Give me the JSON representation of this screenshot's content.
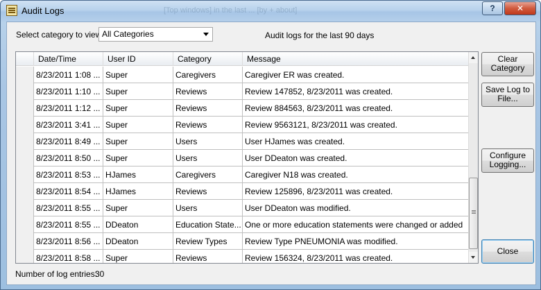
{
  "window": {
    "title": "Audit Logs",
    "help_label": "?",
    "close_label": "✕",
    "background_title": "[Top windows] in the last ... [by + about]"
  },
  "filter": {
    "label": "Select category to view:",
    "selected": "All Categories",
    "note": "Audit logs for the last 90 days"
  },
  "grid": {
    "columns": [
      "Date/Time",
      "User ID",
      "Category",
      "Message"
    ],
    "rows": [
      {
        "date": "8/23/2011 1:08 ...",
        "user": "Super",
        "category": "Caregivers",
        "message": "Caregiver ER was created."
      },
      {
        "date": "8/23/2011 1:10 ...",
        "user": "Super",
        "category": "Reviews",
        "message": "Review 147852,  8/23/2011 was created."
      },
      {
        "date": "8/23/2011 1:12 ...",
        "user": "Super",
        "category": "Reviews",
        "message": "Review 884563,  8/23/2011 was created."
      },
      {
        "date": "8/23/2011 3:41 ...",
        "user": "Super",
        "category": "Reviews",
        "message": "Review 9563121,  8/23/2011 was created."
      },
      {
        "date": "8/23/2011 8:49 ...",
        "user": "Super",
        "category": "Users",
        "message": "User HJames was created."
      },
      {
        "date": "8/23/2011 8:50 ...",
        "user": "Super",
        "category": "Users",
        "message": "User DDeaton was created."
      },
      {
        "date": "8/23/2011 8:53 ...",
        "user": "HJames",
        "category": "Caregivers",
        "message": "Caregiver N18 was created."
      },
      {
        "date": "8/23/2011 8:54 ...",
        "user": "HJames",
        "category": "Reviews",
        "message": "Review 125896,  8/23/2011 was created."
      },
      {
        "date": "8/23/2011 8:55 ...",
        "user": "Super",
        "category": "Users",
        "message": "User DDeaton was modified."
      },
      {
        "date": "8/23/2011 8:55 ...",
        "user": "DDeaton",
        "category": "Education State...",
        "message": "One or more education statements were changed or added"
      },
      {
        "date": "8/23/2011 8:56 ...",
        "user": "DDeaton",
        "category": "Review Types",
        "message": "Review Type PNEUMONIA was modified."
      },
      {
        "date": "8/23/2011 8:58 ...",
        "user": "Super",
        "category": "Reviews",
        "message": "Review 156324,  8/23/2011 was created."
      }
    ]
  },
  "buttons": {
    "clear_category": [
      "Clear",
      "Category"
    ],
    "save_log": [
      "Save Log to",
      "File..."
    ],
    "configure_logging": [
      "Configure",
      "Logging..."
    ],
    "close": "Close"
  },
  "footer": {
    "entries_label": "Number of log entries:",
    "entries_value": "30"
  }
}
